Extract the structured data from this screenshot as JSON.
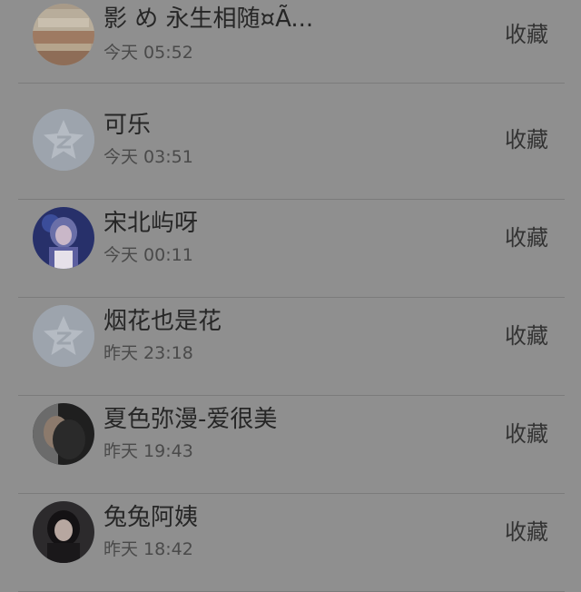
{
  "favorite_list": {
    "action_label": "收藏",
    "items": [
      {
        "name": "影 め 永生相随¤Ã...",
        "time": "今天 05:52",
        "avatar": "book-photo"
      },
      {
        "name": "可乐",
        "time": "今天 03:51",
        "avatar": "default-qzone-avatar"
      },
      {
        "name": "宋北屿呀",
        "time": "今天 00:11",
        "avatar": "girl-blue-stage-photo"
      },
      {
        "name": "烟花也是花",
        "time": "昨天 23:18",
        "avatar": "default-qzone-avatar"
      },
      {
        "name": "夏色弥漫-爱很美",
        "time": "昨天 19:43",
        "avatar": "dark-portrait-photo"
      },
      {
        "name": "兔兔阿姨",
        "time": "昨天 18:42",
        "avatar": "dark-girl-photo"
      }
    ]
  },
  "colors": {
    "overlay_background": "#8f8f8f",
    "name_text": "#262626",
    "time_text": "#4a4a4a",
    "action_text": "#333333",
    "default_avatar_bg": "#9da4ad",
    "default_avatar_star": "#b5bbc3"
  }
}
